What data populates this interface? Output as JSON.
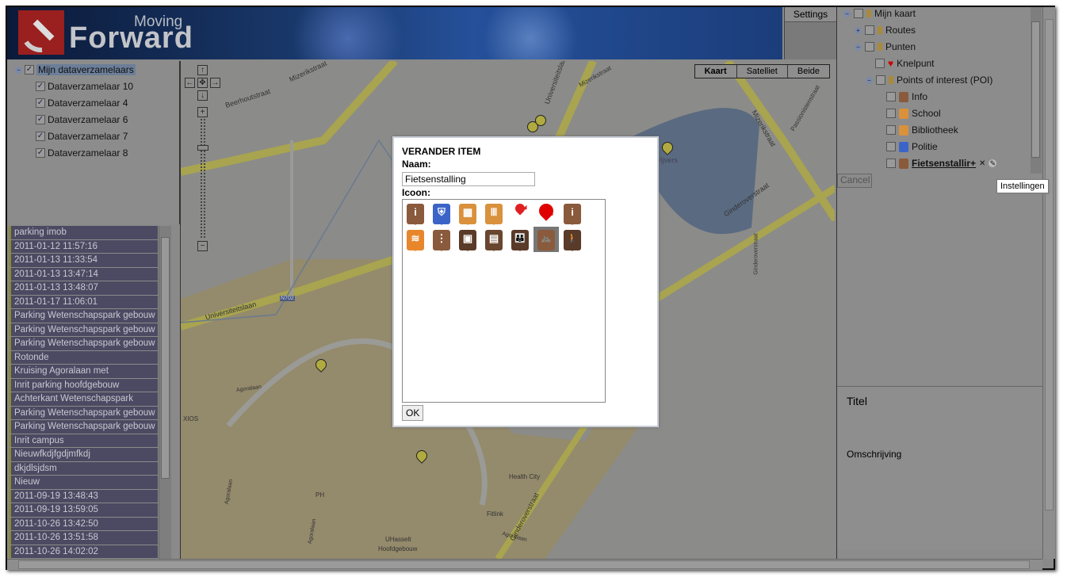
{
  "header": {
    "logo_top": "Moving",
    "logo_bottom": "Forward",
    "settings_label": "Settings"
  },
  "left_tree": {
    "root": "Mijn dataverzamelaars",
    "children": [
      "Dataverzamelaar 10",
      "Dataverzamelaar 4",
      "Dataverzamelaar 6",
      "Dataverzamelaar 7",
      "Dataverzamelaar 8"
    ]
  },
  "left_list": [
    "parking imob",
    "2011-01-12 11:57:16",
    "2011-01-13 11:33:54",
    "2011-01-13 13:47:14",
    "2011-01-13 13:48:07",
    "2011-01-17 11:06:01",
    "Parking Wetenschapspark gebouw",
    "Parking Wetenschapspark gebouw",
    "Parking Wetenschapspark gebouw",
    "Rotonde",
    "Kruising Agoralaan met",
    "Inrit parking hoofdgebouw",
    "Achterkant Wetenschapspark",
    "Parking Wetenschapspark gebouw",
    "Parking Wetenschapspark gebouw",
    "Inrit campus",
    "Nieuwfkdjfgdjmfkdj",
    "dkjdlsjdsm",
    "Nieuw",
    "2011-09-19 13:48:43",
    "2011-09-19 13:59:05",
    "2011-10-26 13:42:50",
    "2011-10-26 13:51:58",
    "2011-10-26 14:02:02"
  ],
  "map": {
    "types": [
      "Kaart",
      "Satelliet",
      "Beide"
    ],
    "selected_type": "Kaart",
    "labels": [
      "Mizerikstraat",
      "Beerhoutstraat",
      "Universiteitslaan",
      "Mizerikstraat",
      "Mizerikstraat",
      "Passionistenstraat",
      "Ginderoverstraat",
      "Universiteitslaan",
      "N702",
      "Agoralaan",
      "XIOS",
      "Agoralaan",
      "PH",
      "Health City",
      "Fitlink",
      "Agoralaan",
      "UHasselt",
      "Hoofdgebouw",
      "Ginderoverstraat",
      "Agoralaan",
      "Ginderoverstraat",
      "Vijvers"
    ]
  },
  "dialog": {
    "title": "VERANDER ITEM",
    "name_label": "Naam:",
    "name_value": "Fietsenstalling",
    "icon_label": "Icoon:",
    "ok_label": "OK",
    "icons": [
      {
        "name": "info-icon",
        "color": "#8a5a3c",
        "glyph": "i"
      },
      {
        "name": "police-icon",
        "color": "#3c64c8",
        "glyph": "⛨"
      },
      {
        "name": "school-icon",
        "color": "#d9913c",
        "glyph": "▦"
      },
      {
        "name": "library-icon",
        "color": "#d9913c",
        "glyph": "Ⅲ"
      },
      {
        "name": "small-red-pin-icon",
        "color": "#e02020",
        "glyph": ""
      },
      {
        "name": "red-pin-icon",
        "color": "#e00000",
        "glyph": ""
      },
      {
        "name": "info-icon",
        "color": "#8a5a3c",
        "glyph": "i"
      },
      {
        "name": "swimming-icon",
        "color": "#e8862c",
        "glyph": "≋"
      },
      {
        "name": "traffic-light-icon",
        "color": "#8a5a3c",
        "glyph": "⋮"
      },
      {
        "name": "train-icon",
        "color": "#5a3a28",
        "glyph": "▣"
      },
      {
        "name": "tram-icon",
        "color": "#6a4630",
        "glyph": "▤"
      },
      {
        "name": "family-icon",
        "color": "#5a3a28",
        "glyph": "👪"
      },
      {
        "name": "bicycle-icon",
        "color": "#8a5a3c",
        "glyph": "🚲"
      },
      {
        "name": "pedestrian-icon",
        "color": "#5a3a28",
        "glyph": "🚶"
      }
    ],
    "selected_icon": "bicycle-icon"
  },
  "right_tree": {
    "root": "Mijn kaart",
    "routes": "Routes",
    "punten": "Punten",
    "knelpunt": "Knelpunt",
    "poi": "Points of interest (POI)",
    "items": [
      {
        "label": "Info",
        "color": "#8a5a3c"
      },
      {
        "label": "School",
        "color": "#d9913c"
      },
      {
        "label": "Bibliotheek",
        "color": "#d9913c"
      },
      {
        "label": "Politie",
        "color": "#3c64c8"
      },
      {
        "label": "Fietsenstallir+",
        "color": "#8a5a3c"
      }
    ],
    "cancel_label": "Cancel",
    "tooltip": "Instellingen",
    "titel_label": "Titel",
    "omschrijving_label": "Omschrijving"
  }
}
